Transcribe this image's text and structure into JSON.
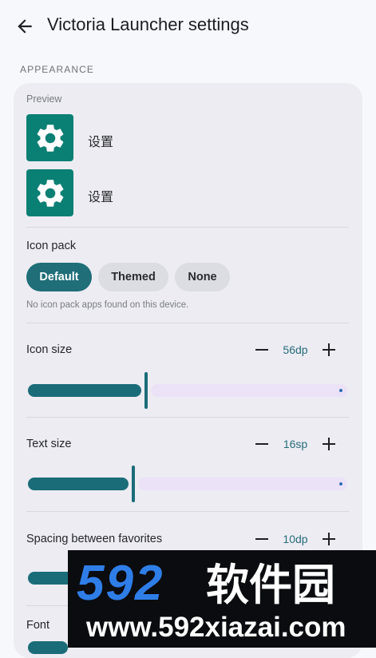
{
  "app_bar": {
    "title": "Victoria Launcher settings",
    "back_icon": "arrow-back-icon"
  },
  "appearance": {
    "section_title": "APPEARANCE",
    "preview": {
      "label": "Preview",
      "items": [
        {
          "icon": "gear-icon",
          "label": "设置"
        },
        {
          "icon": "gear-icon",
          "label": "设置"
        }
      ]
    },
    "icon_pack": {
      "label": "Icon pack",
      "options": [
        "Default",
        "Themed",
        "None"
      ],
      "selected": "Default",
      "note": "No icon pack apps found on this device."
    },
    "icon_size": {
      "label": "Icon size",
      "value": "56dp",
      "level": 0.37
    },
    "text_size": {
      "label": "Text size",
      "value": "16sp",
      "level": 0.33
    },
    "spacing": {
      "label": "Spacing between favorites",
      "value": "10dp"
    },
    "font": {
      "label": "Font"
    }
  },
  "watermark": {
    "logo": "592",
    "text_cn": "软件园",
    "url": "www.592xiazai.com"
  },
  "colors": {
    "primary": "#1b6c79",
    "icon_bg": "#0a7f74",
    "inactive_track": "#ece2f8",
    "card": "#ececf2",
    "background": "#f6f8fb"
  }
}
